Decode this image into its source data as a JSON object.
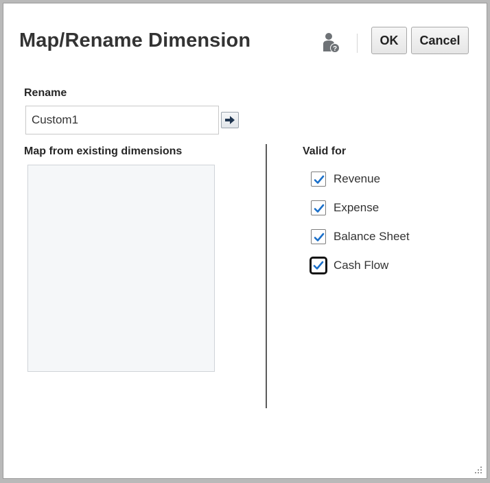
{
  "dialog": {
    "title": "Map/Rename Dimension",
    "ok_label": "OK",
    "cancel_label": "Cancel",
    "help_icon": "user-help-icon"
  },
  "rename": {
    "label": "Rename",
    "value": "Custom1",
    "go_icon": "arrow-right-icon"
  },
  "map": {
    "label": "Map from existing dimensions",
    "items": []
  },
  "valid_for": {
    "label": "Valid for",
    "options": [
      {
        "label": "Revenue",
        "checked": true
      },
      {
        "label": "Expense",
        "checked": true
      },
      {
        "label": "Balance Sheet",
        "checked": true
      },
      {
        "label": "Cash Flow",
        "checked": true,
        "focused": true
      }
    ]
  },
  "colors": {
    "check": "#1a6fc9",
    "title": "#333333"
  }
}
